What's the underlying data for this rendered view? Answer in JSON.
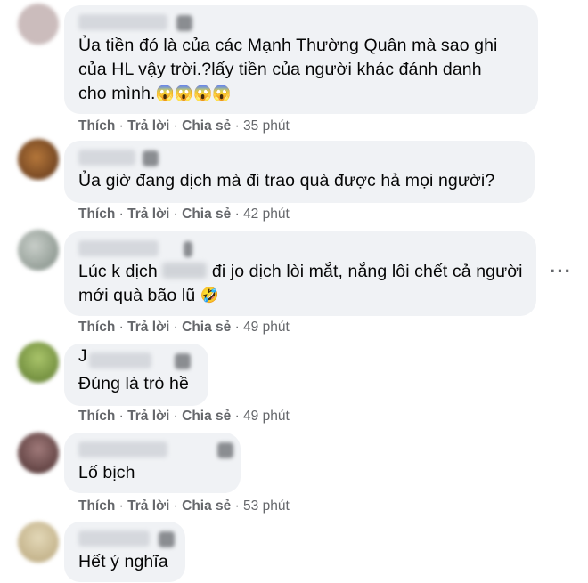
{
  "comments": [
    {
      "text_lines": [
        "Ủa tiền đó là của các Mạnh Thường Quân mà sao ghi",
        "của HL vậy trời.?lấy tiền của người khác đánh danh",
        "cho mình."
      ],
      "emoji": "😱😱😱😱",
      "actions": {
        "like": "Thích",
        "reply": "Trả lời",
        "share": "Chia sẻ",
        "time": "35 phút"
      },
      "avatar_color": "#c9b8b8"
    },
    {
      "text_lines": [
        "Ủa giờ đang dịch mà đi trao quà được hả mọi người?"
      ],
      "actions": {
        "like": "Thích",
        "reply": "Trả lời",
        "share": "Chia sẻ",
        "time": "42 phút"
      },
      "avatar_color": "#8a5a2c"
    },
    {
      "text_lines": [
        "Lúc k dịch",
        "đi jo dịch lòi mắt, nắng lôi chết cả người",
        "mới quà bão lũ"
      ],
      "emoji": "🤣",
      "actions": {
        "like": "Thích",
        "reply": "Trả lời",
        "share": "Chia sẻ",
        "time": "49 phút"
      },
      "more_icon": "···",
      "avatar_color": "#9ea6a0"
    },
    {
      "author_initial": "J",
      "text_lines": [
        "Đúng là trò hề"
      ],
      "actions": {
        "like": "Thích",
        "reply": "Trả lời",
        "share": "Chia sẻ",
        "time": "49 phút"
      },
      "avatar_color": "#7f9a4a"
    },
    {
      "text_lines": [
        "Lố bịch"
      ],
      "actions": {
        "like": "Thích",
        "reply": "Trả lời",
        "share": "Chia sẻ",
        "time": "53 phút"
      },
      "avatar_color": "#6b4a4a"
    },
    {
      "text_lines": [
        "Hết ý nghĩa"
      ],
      "avatar_color": "#cfc2a0"
    }
  ],
  "separator": " · "
}
